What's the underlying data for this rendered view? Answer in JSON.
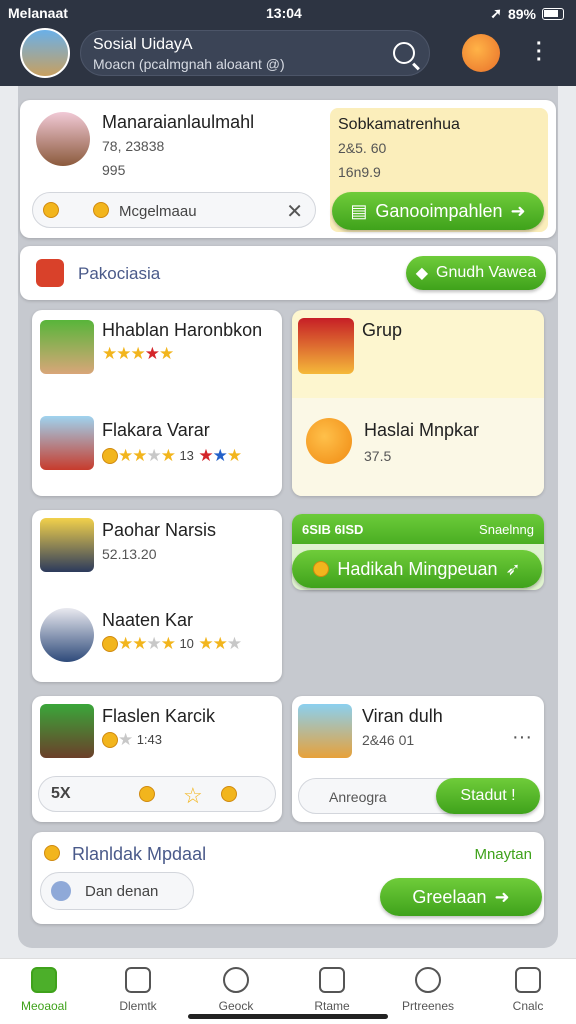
{
  "status": {
    "carrier": "Melanaat",
    "time": "13:04",
    "battery": "89%"
  },
  "header": {
    "title": "Sosial UidayA",
    "subtitle": "Moacn (pcalmgnah aloaant @)"
  },
  "profile_card": {
    "name": "Manaraianlaulmahl",
    "line1": "78, 23838",
    "line2": "995",
    "input_value": "Mcgelmaau",
    "right_title": "Sobkamatrenhua",
    "right_line1": "2&5. 60",
    "right_line2": "16n9.9",
    "button": "Ganooimpahlen"
  },
  "section_bar": {
    "label": "Pakociasia",
    "button": "Gnudh Vawea"
  },
  "friends": [
    {
      "name": "Hhablan Haronbkon"
    },
    {
      "name": "Flakara Varar",
      "rating_text": "13"
    },
    {
      "name": "Paohar Narsis",
      "line": "52.13.20"
    },
    {
      "name": "Naaten Kar",
      "rating_text": "10"
    },
    {
      "name": "Flaslen Karcik",
      "line": "1:43"
    }
  ],
  "group_card": {
    "title": "Grup",
    "item": "Haslai Mnpkar",
    "item_value": "37.5"
  },
  "gift_card": {
    "header_left": "6SIB 6ISD",
    "header_right": "Snaelnng",
    "button": "Hadikah Mingpeuan"
  },
  "vivian_card": {
    "name": "Viran dulh",
    "line": "2&46 01",
    "input": "Anreogra",
    "button": "Stadut !"
  },
  "bottom_card": {
    "title": "Rlanldak Mpdaal",
    "right_label": "Mnaytan",
    "input": "Dan denan",
    "button": "Greelaan"
  },
  "rewards_row": {
    "label": "5X"
  },
  "nav": [
    {
      "label": "Meoaoal"
    },
    {
      "label": "Dlemtk"
    },
    {
      "label": "Geock"
    },
    {
      "label": "Rtame"
    },
    {
      "label": "Prtreenes"
    },
    {
      "label": "Cnalc"
    }
  ],
  "colors": {
    "accent_green": "#4caf2a",
    "header_bg": "#2d3442"
  }
}
